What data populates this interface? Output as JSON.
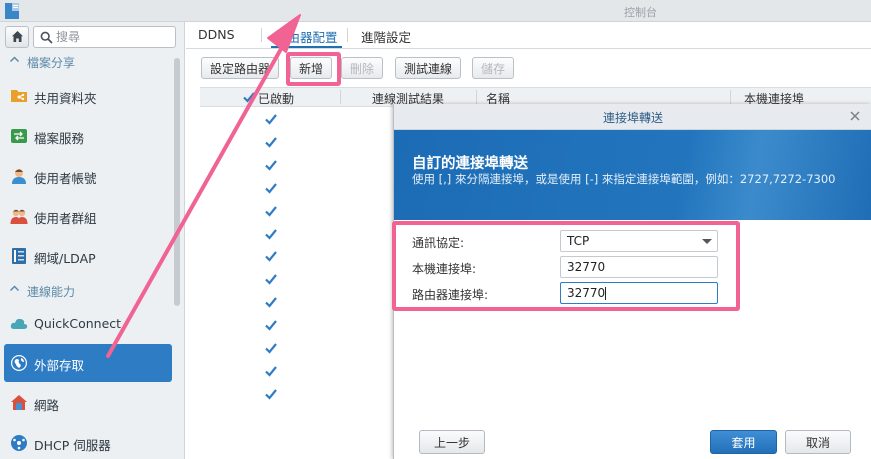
{
  "window": {
    "title": "控制台"
  },
  "sidebar": {
    "search_placeholder": "搜尋",
    "sections": [
      {
        "label": "檔案分享"
      },
      {
        "label": "連線能力"
      }
    ],
    "items": [
      {
        "label": "共用資料夾",
        "icon": "shared-folder-icon"
      },
      {
        "label": "檔案服務",
        "icon": "file-services-icon"
      },
      {
        "label": "使用者帳號",
        "icon": "user-icon"
      },
      {
        "label": "使用者群組",
        "icon": "group-icon"
      },
      {
        "label": "網域/LDAP",
        "icon": "domain-ldap-icon"
      },
      {
        "label": "QuickConnect",
        "icon": "quickconnect-cloud-icon"
      },
      {
        "label": "外部存取",
        "icon": "globe-icon",
        "active": true
      },
      {
        "label": "網路",
        "icon": "network-house-icon"
      },
      {
        "label": "DHCP 伺服器",
        "icon": "dhcp-icon"
      }
    ]
  },
  "tabs": [
    {
      "label": "DDNS"
    },
    {
      "label": "路由器配置",
      "active": true
    },
    {
      "label": "進階設定"
    }
  ],
  "toolbar": {
    "setup_router": "設定路由器",
    "add": "新增",
    "delete": "刪除",
    "test_connection": "測試連線",
    "save": "儲存"
  },
  "grid": {
    "columns": [
      "已啟動",
      "連線測試結果",
      "名稱",
      "本機連接埠"
    ],
    "enabled_rows": 13
  },
  "dialog": {
    "title": "連接埠轉送",
    "heading": "自訂的連接埠轉送",
    "description": "使用 [,] 來分隔連接埠，或是使用 [-] 來指定連接埠範圍，例如：2727,7272-7300",
    "fields": {
      "protocol_label": "通訊協定:",
      "protocol_value": "TCP",
      "local_port_label": "本機連接埠:",
      "local_port_value": "32770",
      "router_port_label": "路由器連接埠:",
      "router_port_value": "32770"
    },
    "buttons": {
      "back": "上一步",
      "apply": "套用",
      "cancel": "取消"
    }
  },
  "colors": {
    "accent": "#2e7cc4",
    "highlight": "#f06392",
    "header_blue": "#1c6cb5"
  }
}
